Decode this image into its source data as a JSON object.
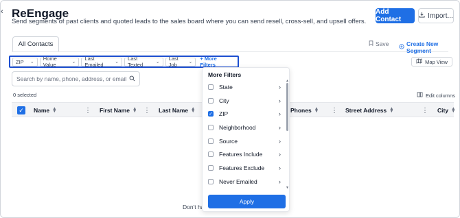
{
  "header": {
    "title": "ReEngage",
    "subtitle": "Send segments of past clients and quoted leads to the sales board where you can send resell, cross-sell, and upsell offers.",
    "add_contact": "Add Contact",
    "import": "Import..."
  },
  "tabs": [
    {
      "label": "All Contacts",
      "active": true
    }
  ],
  "actions": {
    "save": "Save",
    "create_segment": "Create New Segment",
    "map_view": "Map View",
    "edit_columns": "Edit columns"
  },
  "filters": {
    "chips": [
      "ZIP",
      "Home Value",
      "Last Emailed",
      "Last Texted",
      "Last Job"
    ],
    "more_filters": "+ More Filters"
  },
  "search": {
    "placeholder": "Search by name, phone, address, or email...",
    "value": ""
  },
  "selection": {
    "count_text": "0 selected"
  },
  "table": {
    "columns": [
      "Name",
      "First Name",
      "Last Name",
      "Phones",
      "Street Address",
      "City"
    ]
  },
  "empty_state": {
    "text": "Don't ha"
  },
  "more_filters_menu": {
    "title": "More Filters",
    "options": [
      {
        "label": "State",
        "checked": false
      },
      {
        "label": "City",
        "checked": false
      },
      {
        "label": "ZIP",
        "checked": true
      },
      {
        "label": "Neighborhood",
        "checked": false
      },
      {
        "label": "Source",
        "checked": false
      },
      {
        "label": "Features Include",
        "checked": false
      },
      {
        "label": "Features Exclude",
        "checked": false
      },
      {
        "label": "Never Emailed",
        "checked": false
      }
    ],
    "apply": "Apply"
  },
  "colors": {
    "accent": "#1f6fe5",
    "highlight_border": "#1d4fd0"
  }
}
